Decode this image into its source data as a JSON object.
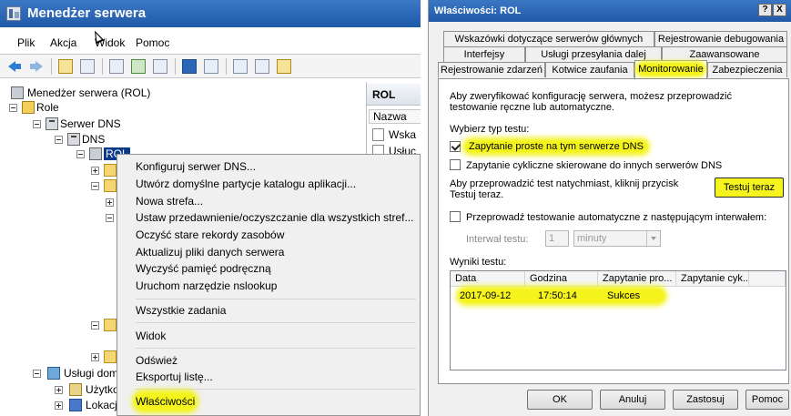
{
  "left_window": {
    "title": "Menedżer serwera",
    "menu": [
      "Plik",
      "Akcja",
      "Widok",
      "Pomoc"
    ],
    "tree": {
      "root": "Menedżer serwera (ROL)",
      "roles": "Role",
      "dns_server": "Serwer DNS",
      "dns": "DNS",
      "rol": "ROL",
      "domain_services": "Usługi dom",
      "users": "Użytko",
      "sites": "Lokacj"
    },
    "right_pane": {
      "header": "ROL",
      "column": "Nazwa",
      "items": [
        "Wska",
        "Usłuc"
      ]
    },
    "context_menu": {
      "items": [
        "Konfiguruj serwer DNS...",
        "Utwórz domyślne partycje katalogu aplikacji...",
        "Nowa strefa...",
        "Ustaw przedawnienie/oczyszczanie dla wszystkich stref...",
        "Oczyść stare rekordy zasobów",
        "Aktualizuj pliki danych serwera",
        "Wyczyść pamięć podręczną",
        "Uruchom narzędzie nslookup",
        "Wszystkie zadania",
        "Widok",
        "Odśwież",
        "Eksportuj listę...",
        "Właściwości"
      ]
    }
  },
  "dialog": {
    "title": "Właściwości: ROL",
    "title_buttons": [
      "?",
      "X"
    ],
    "tabs_row1": [
      "Wskazówki dotyczące serwerów głównych",
      "Rejestrowanie debugowania"
    ],
    "tabs_row2": [
      "Interfejsy",
      "Usługi przesyłania dalej",
      "Zaawansowane"
    ],
    "tabs_row3": [
      "Rejestrowanie zdarzeń",
      "Kotwice zaufania",
      "Monitorowanie",
      "Zabezpieczenia"
    ],
    "intro": "Aby zweryfikować konfigurację serwera, możesz przeprowadzić testowanie ręczne lub automatyczne.",
    "select_type": "Wybierz typ testu:",
    "simple_query": "Zapytanie proste na tym serwerze DNS",
    "simple_query_checked": true,
    "recursive_query": "Zapytanie cykliczne skierowane do innych serwerów DNS",
    "recursive_query_checked": false,
    "test_now_text": "Aby przeprowadzić test natychmiast, kliknij przycisk Testuj teraz.",
    "test_now_button": "Testuj teraz",
    "auto_test": "Przeprowadź testowanie automatyczne z następującym interwałem:",
    "auto_test_checked": false,
    "interval_label": "Interwał testu:",
    "interval_value": "1",
    "interval_unit": "minuty",
    "results_label": "Wyniki testu:",
    "results_columns": [
      "Data",
      "Godzina",
      "Zapytanie pro...",
      "Zapytanie cyk..."
    ],
    "results_rows": [
      {
        "date": "2017-09-12",
        "time": "17:50:14",
        "simple": "Sukces",
        "recursive": ""
      }
    ],
    "buttons": [
      "OK",
      "Anuluj",
      "Zastosuj",
      "Pomoc"
    ],
    "highlight_color": "#f4f41c"
  }
}
